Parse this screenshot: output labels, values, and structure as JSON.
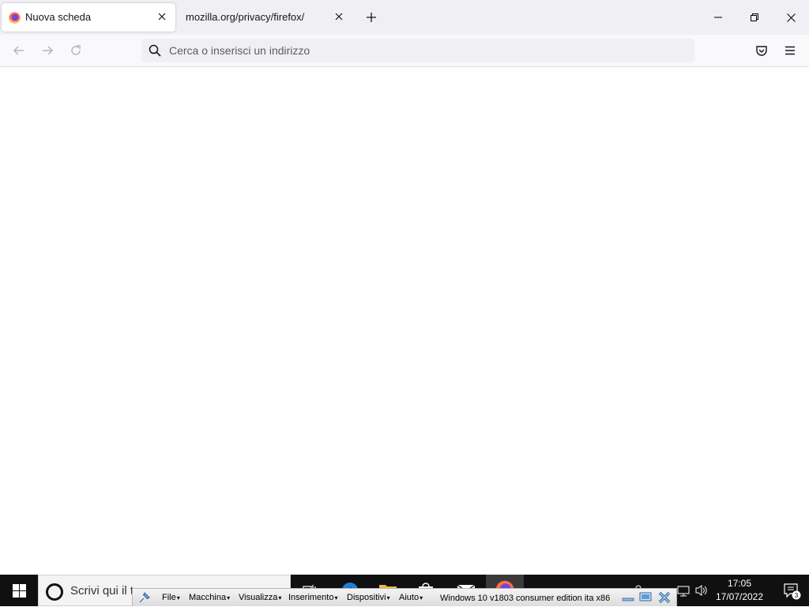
{
  "browser": {
    "tabs": [
      {
        "title": "Nuova scheda",
        "active": true,
        "icon": "firefox-icon"
      },
      {
        "title": "mozilla.org/privacy/firefox/",
        "active": false
      }
    ],
    "urlbar_placeholder": "Cerca o inserisci un indirizzo",
    "colors": {
      "tabstrip": "#f0f0f4",
      "toolbar": "#f9f9fb",
      "urlbar": "#f0f0f4"
    }
  },
  "taskbar": {
    "search_text": "Scrivi qui il te",
    "clock_time": "17:05",
    "clock_date": "17/07/2022",
    "notification_count": "3",
    "apps": [
      "task-view-icon",
      "edge-icon",
      "file-explorer-icon",
      "store-icon",
      "mail-icon",
      "firefox-icon"
    ]
  },
  "vbox_toolbar": {
    "menus": [
      "File",
      "Macchina",
      "Visualizza",
      "Inserimento",
      "Dispositivi",
      "Aiuto"
    ],
    "vm_name": "Windows 10 v1803 consumer edition ita x86"
  }
}
